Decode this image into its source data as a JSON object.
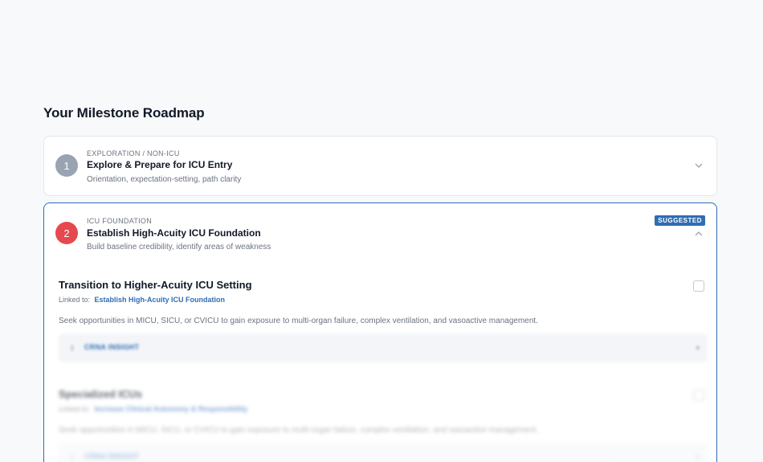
{
  "page": {
    "title": "Your Milestone Roadmap"
  },
  "phases": [
    {
      "step": "1",
      "eyebrow": "EXPLORATION / NON-ICU",
      "title": "Explore & Prepare for ICU Entry",
      "description": "Orientation, expectation-setting, path clarity",
      "expanded": false,
      "color": "#9aa3b2"
    },
    {
      "step": "2",
      "eyebrow": "ICU FOUNDATION",
      "title": "Establish High-Acuity ICU Foundation",
      "description": "Build baseline credibility, identify areas of weakness",
      "badge": "SUGGESTED",
      "expanded": true,
      "color": "#e5484d",
      "milestones": [
        {
          "title": "Transition to Higher-Acuity ICU Setting",
          "linked_prefix": "Linked to:",
          "linked_value": "Establish High-Acuity ICU Foundation",
          "description": "Seek opportunities in MICU, SICU, or CVICU to gain exposure to multi-organ failure, complex ventilation, and vasoactive management.",
          "insight_label": "CRNA INSIGHT",
          "checked": false
        },
        {
          "title": "Specialized ICUs",
          "linked_prefix": "Linked to:",
          "linked_value": "Increase Clinical Autonomy & Responsibility",
          "description": "Seek opportunities in MICU, SICU, or CVICU to gain exposure to multi-organ failure, complex ventilation, and vasoactive management.",
          "insight_label": "CRNA INSIGHT",
          "checked": false
        }
      ]
    }
  ],
  "colors": {
    "accent": "#2f6db3",
    "background": "#f8f9fb"
  }
}
